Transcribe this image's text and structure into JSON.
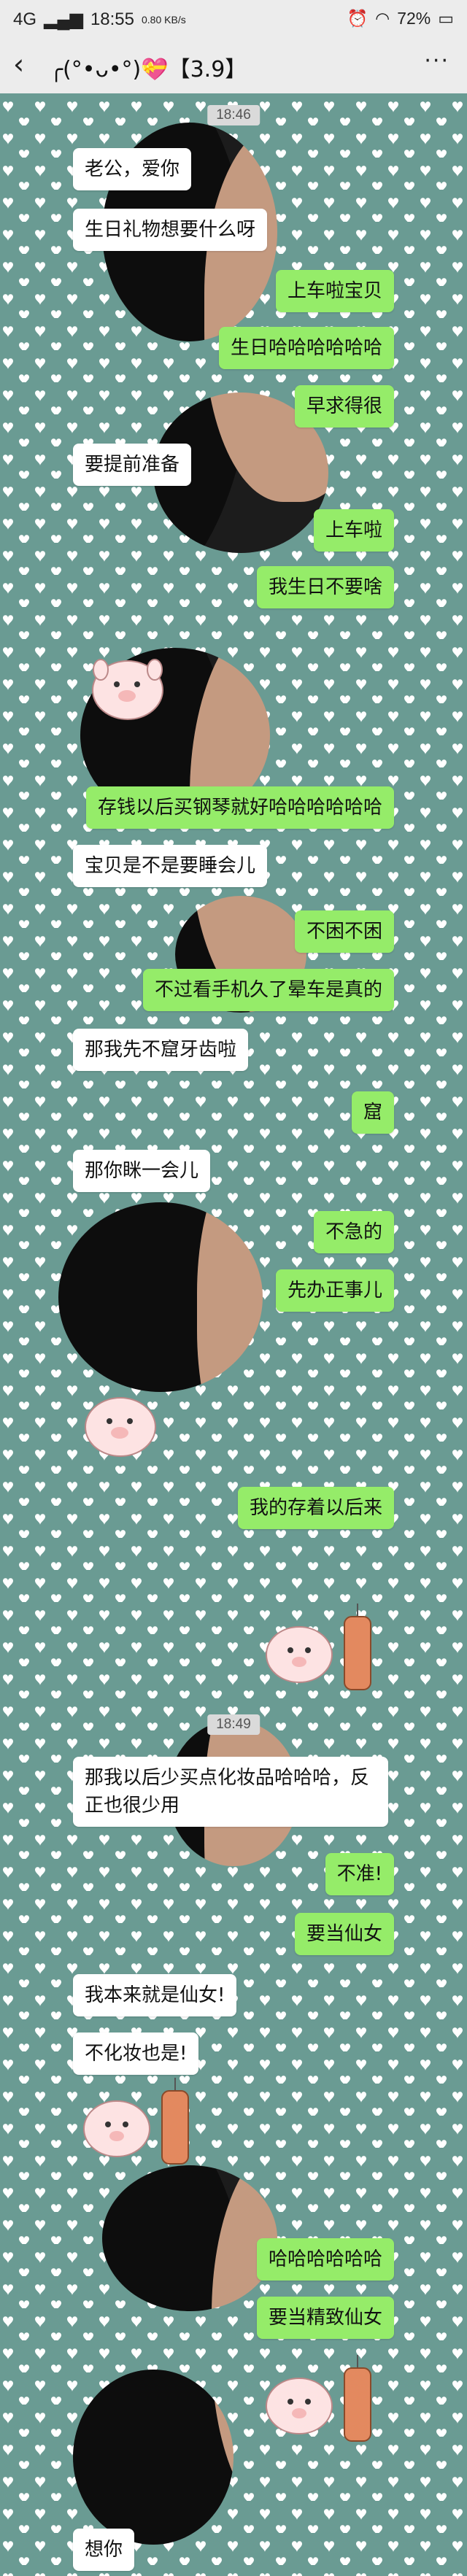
{
  "status": {
    "time": "18:55",
    "network": "4G",
    "speed": "0.80 KB/s",
    "battery": "72%"
  },
  "header": {
    "back_icon": "chevron-left-icon",
    "title": "╭(°•ᴗ•°)💝【3.9】",
    "more_icon": "more-dots-icon"
  },
  "messages": [
    {
      "type": "time",
      "text": "18:46"
    },
    {
      "side": "left",
      "text": "老公，爱你"
    },
    {
      "side": "left",
      "text": "生日礼物想要什么呀"
    },
    {
      "side": "right",
      "text": "上车啦宝贝"
    },
    {
      "side": "right",
      "text": "生日哈哈哈哈哈哈"
    },
    {
      "side": "right",
      "text": "早求得很"
    },
    {
      "side": "left",
      "text": "要提前准备"
    },
    {
      "side": "right",
      "text": "上车啦"
    },
    {
      "side": "right",
      "text": "我生日不要啥"
    },
    {
      "side": "right",
      "text": "存钱以后买钢琴就好哈哈哈哈哈哈"
    },
    {
      "side": "left",
      "text": "宝贝是不是要睡会儿"
    },
    {
      "side": "right",
      "text": "不困不困"
    },
    {
      "side": "right",
      "text": "不过看手机久了晕车是真的"
    },
    {
      "side": "left",
      "text": "那我先不窟牙齿啦"
    },
    {
      "side": "right",
      "text": "窟"
    },
    {
      "side": "left",
      "text": "那你眯一会儿"
    },
    {
      "side": "right",
      "text": "不急的"
    },
    {
      "side": "right",
      "text": "先办正事儿"
    },
    {
      "side": "right",
      "text": "我的存着以后来"
    },
    {
      "type": "time",
      "text": "18:49"
    },
    {
      "side": "left",
      "text": "那我以后少买点化妆品哈哈哈，反正也很少用"
    },
    {
      "side": "right",
      "text": "不准!"
    },
    {
      "side": "right",
      "text": "要当仙女"
    },
    {
      "side": "left",
      "text": "我本来就是仙女!"
    },
    {
      "side": "left",
      "text": "不化妆也是!"
    },
    {
      "side": "right",
      "text": "哈哈哈哈哈哈"
    },
    {
      "side": "right",
      "text": "要当精致仙女"
    },
    {
      "side": "left",
      "text": "想你"
    }
  ],
  "colors": {
    "overlay_teal": "#6a9b93",
    "heart": "#ffffff",
    "bubble_right": "#95ec69",
    "bubble_left": "#ffffff"
  }
}
